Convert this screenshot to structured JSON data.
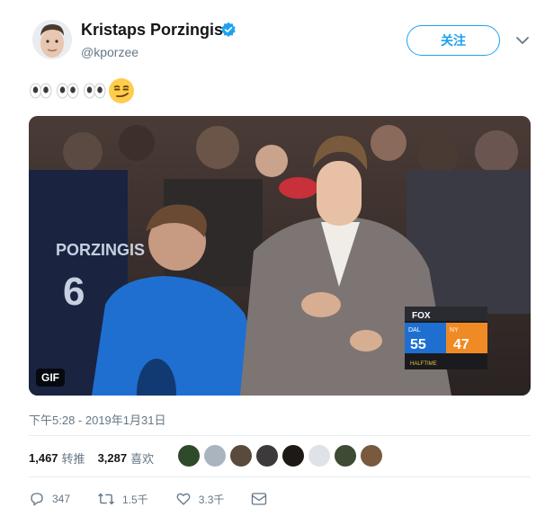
{
  "author": {
    "name": "Kristaps Porzingis",
    "handle": "@kporzee",
    "verified": true
  },
  "follow_label": "关注",
  "tweet_emojis": [
    "👀",
    "👀",
    "👀",
    "😏"
  ],
  "media": {
    "badge": "GIF",
    "scoreboard": {
      "network": "FOX",
      "away_team": "DAL",
      "away_score": "55",
      "home_team": "NY",
      "home_score": "47",
      "period": "HALFTIME"
    },
    "jersey_name": "PORZINGIS",
    "jersey_number": "6"
  },
  "timestamp": "下午5:28 - 2019年1月31日",
  "stats": {
    "retweets_count": "1,467",
    "retweets_label": "转推",
    "likes_count": "3,287",
    "likes_label": "喜欢"
  },
  "liker_avatar_colors": [
    "#2f4a2a",
    "#aab4bf",
    "#5a4a3c",
    "#3c3a3a",
    "#1d1a16",
    "#dfe3e8",
    "#3d4a34",
    "#7a5a3f"
  ],
  "actions": {
    "reply_count": "347",
    "retweet_count": "1.5千",
    "like_count": "3.3千"
  },
  "colors": {
    "accent": "#1da1f2",
    "secondary_text": "#657786",
    "dal_blue": "#1f6fd1",
    "ny_orange": "#f08a24"
  }
}
